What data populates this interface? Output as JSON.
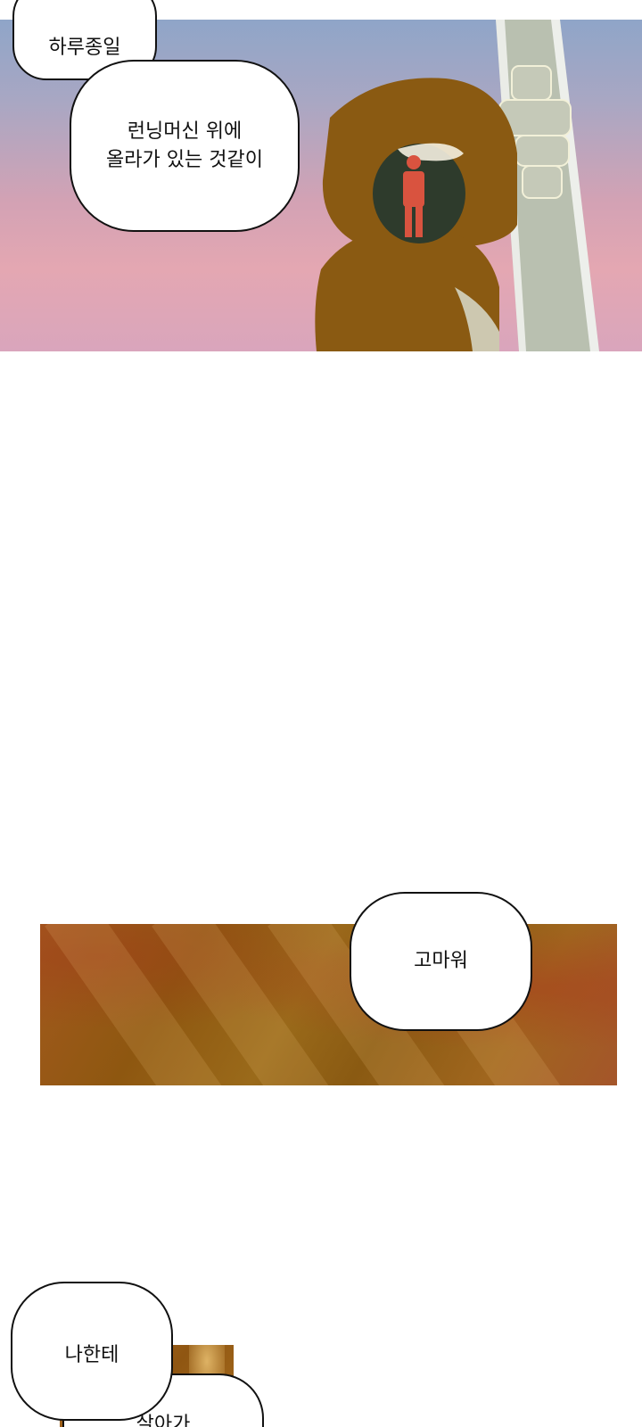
{
  "bubbles": {
    "all_day": "하루종일",
    "treadmill": "런닝머신 위에\n올라가 있는 것같이",
    "thanks": "고마워",
    "to_me": "나한테",
    "partial": "살아가"
  },
  "colors": {
    "sky_top": "#8fa5c8",
    "sky_bottom": "#e4a7b2",
    "signal_housing": "#8a5a12",
    "pedestrian_red": "#d9533f",
    "pole": "#b9c0b0",
    "warm_panel": "#8e5710"
  }
}
